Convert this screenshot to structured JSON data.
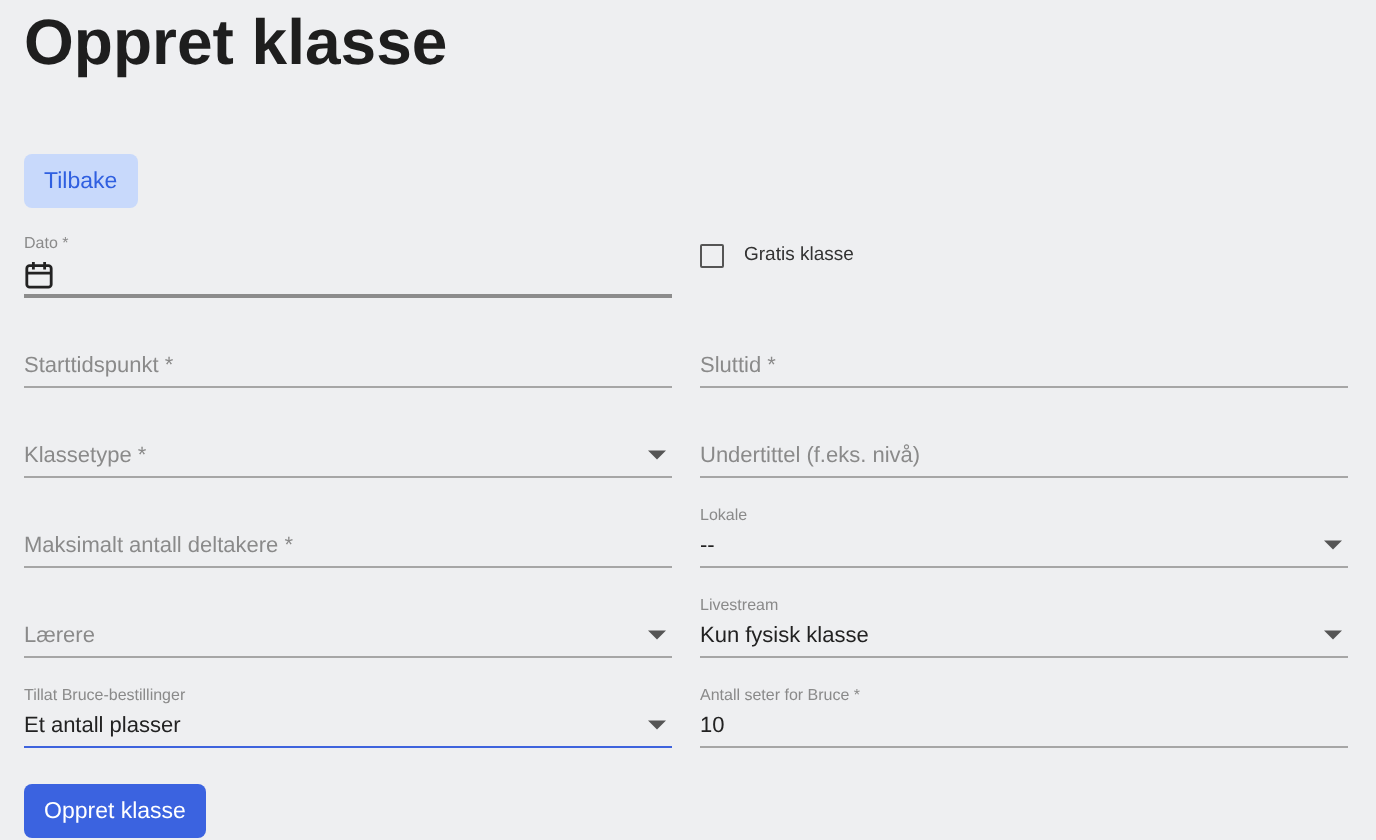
{
  "title": "Oppret klasse",
  "back_button": "Tilbake",
  "fields": [
    {
      "kind": "date",
      "label": "Dato *",
      "focused": false
    },
    {
      "kind": "checkbox",
      "label": "Gratis klasse",
      "checked": false
    },
    {
      "kind": "text",
      "label": "Starttidspunkt *",
      "focused": false
    },
    {
      "kind": "text",
      "label": "Sluttid *",
      "focused": false
    },
    {
      "kind": "select",
      "label": "Klassetype *",
      "focused": false
    },
    {
      "kind": "text",
      "label": "Undertittel (f.eks. nivå)",
      "focused": false
    },
    {
      "kind": "text",
      "label": "Maksimalt antall deltakere *",
      "focused": false
    },
    {
      "kind": "select",
      "label": "Lokale",
      "value": "--",
      "focused": false
    },
    {
      "kind": "select",
      "label": "Lærere",
      "focused": false
    },
    {
      "kind": "select",
      "label": "Livestream",
      "value": "Kun fysisk klasse",
      "focused": false
    },
    {
      "kind": "select",
      "label": "Tillat Bruce-bestillinger",
      "value": "Et antall plasser",
      "focused": true
    },
    {
      "kind": "text",
      "label": "Antall seter for Bruce *",
      "value": "10",
      "focused": false
    }
  ],
  "submit_button": "Oppret klasse"
}
